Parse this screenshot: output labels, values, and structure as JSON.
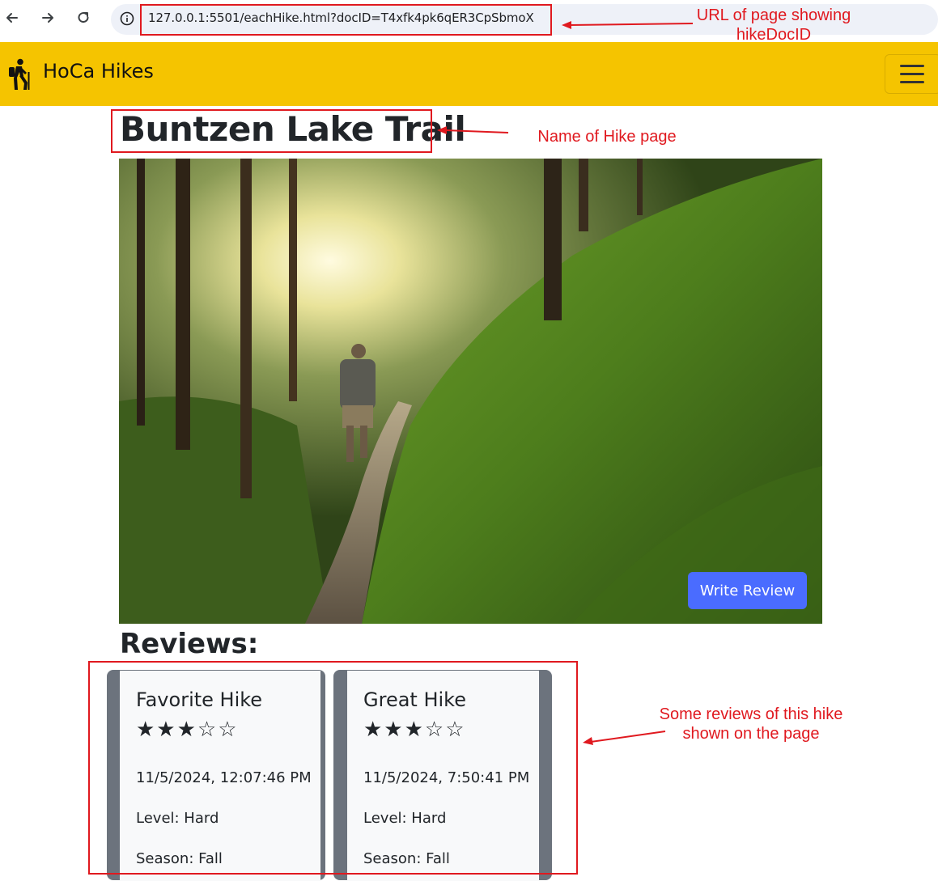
{
  "browser": {
    "url": "127.0.0.1:5501/eachHike.html?docID=T4xfk4pk6qER3CpSbmoX"
  },
  "app": {
    "brand": "HoCa Hikes"
  },
  "hike": {
    "title": "Buntzen Lake Trail",
    "write_review_label": "Write Review"
  },
  "reviews": {
    "heading": "Reviews:",
    "items": [
      {
        "title": "Favorite Hike",
        "rating": 3,
        "max_rating": 5,
        "stars": "★★★☆☆",
        "timestamp": "11/5/2024, 12:07:46 PM",
        "level": "Level: Hard",
        "season": "Season: Fall"
      },
      {
        "title": "Great Hike",
        "rating": 3,
        "max_rating": 5,
        "stars": "★★★☆☆",
        "timestamp": "11/5/2024, 7:50:41 PM",
        "level": "Level: Hard",
        "season": "Season: Fall"
      }
    ]
  },
  "annotations": {
    "url_note": "URL of page showing hikeDocID",
    "name_note": "Name of Hike page",
    "reviews_note": "Some reviews of this hike shown on the page"
  },
  "colors": {
    "navbar": "#f5c400",
    "annotation": "#e0191f",
    "primary_button": "#4a6cff",
    "card_frame": "#6c737d"
  }
}
